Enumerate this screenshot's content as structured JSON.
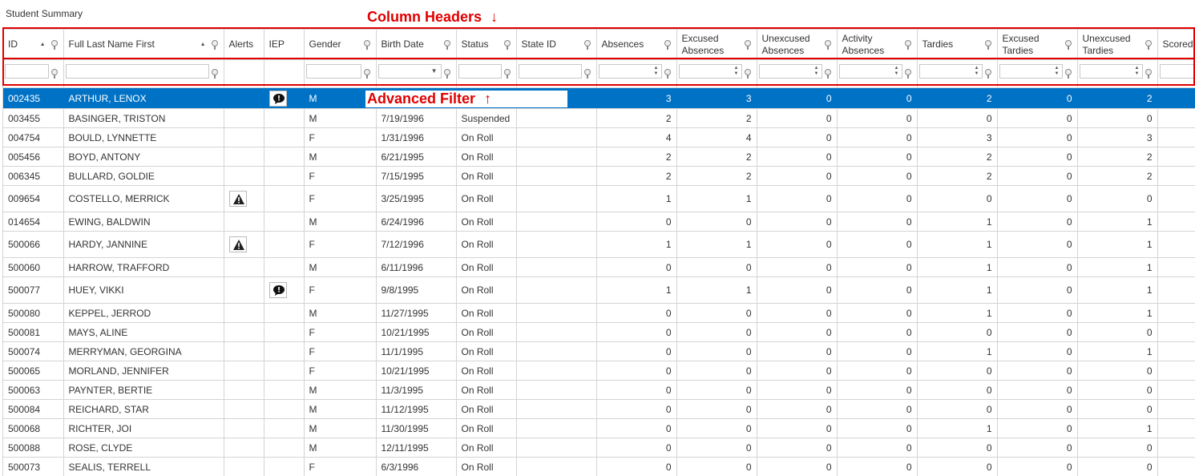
{
  "window": {
    "title": "Student Summary"
  },
  "annotations": {
    "column_headers": "Column Headers",
    "advanced_filter": "Advanced Filter",
    "color": "#e00000"
  },
  "colors": {
    "selected_row": "#0072c6"
  },
  "columns": [
    {
      "key": "id",
      "label": "ID",
      "sorted": "asc",
      "filter": "text"
    },
    {
      "key": "name",
      "label": "Full Last Name First",
      "sorted": "asc",
      "filter": "text"
    },
    {
      "key": "alerts",
      "label": "Alerts",
      "filter": "none"
    },
    {
      "key": "iep",
      "label": "IEP",
      "filter": "none"
    },
    {
      "key": "gender",
      "label": "Gender",
      "filter": "text"
    },
    {
      "key": "birth",
      "label": "Birth Date",
      "filter": "dropdown"
    },
    {
      "key": "status",
      "label": "Status",
      "filter": "text"
    },
    {
      "key": "stateid",
      "label": "State ID",
      "filter": "text"
    },
    {
      "key": "absences",
      "label": "Absences",
      "filter": "spin"
    },
    {
      "key": "excabs",
      "label": "Excused Absences",
      "filter": "spin"
    },
    {
      "key": "unexabs",
      "label": "Unexcused Absences",
      "filter": "spin"
    },
    {
      "key": "actabs",
      "label": "Activity Absences",
      "filter": "spin"
    },
    {
      "key": "tardies",
      "label": "Tardies",
      "filter": "spin"
    },
    {
      "key": "exctard",
      "label": "Excused Tardies",
      "filter": "spin"
    },
    {
      "key": "unextard",
      "label": "Unexcused Tardies",
      "filter": "spin"
    },
    {
      "key": "scored",
      "label": "Scored",
      "filter": "text"
    }
  ],
  "rows": [
    {
      "id": "002435",
      "name": "ARTHUR, LENOX",
      "alert": "",
      "iep": "speech-icon",
      "gender": "M",
      "birth": "",
      "status": "",
      "vals": [
        "3",
        "3",
        "0",
        "0",
        "2",
        "0",
        "2"
      ],
      "selected": true
    },
    {
      "id": "003455",
      "name": "BASINGER, TRISTON",
      "alert": "",
      "iep": "",
      "gender": "M",
      "birth": "7/19/1996",
      "status": "Suspended",
      "vals": [
        "2",
        "2",
        "0",
        "0",
        "0",
        "0",
        "0"
      ]
    },
    {
      "id": "004754",
      "name": "BOULD, LYNNETTE",
      "alert": "",
      "iep": "",
      "gender": "F",
      "birth": "1/31/1996",
      "status": "On Roll",
      "vals": [
        "4",
        "4",
        "0",
        "0",
        "3",
        "0",
        "3"
      ]
    },
    {
      "id": "005456",
      "name": "BOYD, ANTONY",
      "alert": "",
      "iep": "",
      "gender": "M",
      "birth": "6/21/1995",
      "status": "On Roll",
      "vals": [
        "2",
        "2",
        "0",
        "0",
        "2",
        "0",
        "2"
      ]
    },
    {
      "id": "006345",
      "name": "BULLARD, GOLDIE",
      "alert": "",
      "iep": "",
      "gender": "F",
      "birth": "7/15/1995",
      "status": "On Roll",
      "vals": [
        "2",
        "2",
        "0",
        "0",
        "2",
        "0",
        "2"
      ]
    },
    {
      "id": "009654",
      "name": "COSTELLO, MERRICK",
      "alert": "warning-icon",
      "iep": "",
      "gender": "F",
      "birth": "3/25/1995",
      "status": "On Roll",
      "vals": [
        "1",
        "1",
        "0",
        "0",
        "0",
        "0",
        "0"
      ]
    },
    {
      "id": "014654",
      "name": "EWING, BALDWIN",
      "alert": "",
      "iep": "",
      "gender": "M",
      "birth": "6/24/1996",
      "status": "On Roll",
      "vals": [
        "0",
        "0",
        "0",
        "0",
        "1",
        "0",
        "1"
      ]
    },
    {
      "id": "500066",
      "name": "HARDY, JANNINE",
      "alert": "warning-icon",
      "iep": "",
      "gender": "F",
      "birth": "7/12/1996",
      "status": "On Roll",
      "vals": [
        "1",
        "1",
        "0",
        "0",
        "1",
        "0",
        "1"
      ]
    },
    {
      "id": "500060",
      "name": "HARROW, TRAFFORD",
      "alert": "",
      "iep": "",
      "gender": "M",
      "birth": "6/11/1996",
      "status": "On Roll",
      "vals": [
        "0",
        "0",
        "0",
        "0",
        "1",
        "0",
        "1"
      ]
    },
    {
      "id": "500077",
      "name": "HUEY, VIKKI",
      "alert": "",
      "iep": "speech-icon",
      "gender": "F",
      "birth": "9/8/1995",
      "status": "On Roll",
      "vals": [
        "1",
        "1",
        "0",
        "0",
        "1",
        "0",
        "1"
      ]
    },
    {
      "id": "500080",
      "name": "KEPPEL, JERROD",
      "alert": "",
      "iep": "",
      "gender": "M",
      "birth": "11/27/1995",
      "status": "On Roll",
      "vals": [
        "0",
        "0",
        "0",
        "0",
        "1",
        "0",
        "1"
      ]
    },
    {
      "id": "500081",
      "name": "MAYS, ALINE",
      "alert": "",
      "iep": "",
      "gender": "F",
      "birth": "10/21/1995",
      "status": "On Roll",
      "vals": [
        "0",
        "0",
        "0",
        "0",
        "0",
        "0",
        "0"
      ]
    },
    {
      "id": "500074",
      "name": "MERRYMAN, GEORGINA",
      "alert": "",
      "iep": "",
      "gender": "F",
      "birth": "11/1/1995",
      "status": "On Roll",
      "vals": [
        "0",
        "0",
        "0",
        "0",
        "1",
        "0",
        "1"
      ]
    },
    {
      "id": "500065",
      "name": "MORLAND, JENNIFER",
      "alert": "",
      "iep": "",
      "gender": "F",
      "birth": "10/21/1995",
      "status": "On Roll",
      "vals": [
        "0",
        "0",
        "0",
        "0",
        "0",
        "0",
        "0"
      ]
    },
    {
      "id": "500063",
      "name": "PAYNTER, BERTIE",
      "alert": "",
      "iep": "",
      "gender": "M",
      "birth": "11/3/1995",
      "status": "On Roll",
      "vals": [
        "0",
        "0",
        "0",
        "0",
        "0",
        "0",
        "0"
      ]
    },
    {
      "id": "500084",
      "name": "REICHARD, STAR",
      "alert": "",
      "iep": "",
      "gender": "M",
      "birth": "11/12/1995",
      "status": "On Roll",
      "vals": [
        "0",
        "0",
        "0",
        "0",
        "0",
        "0",
        "0"
      ]
    },
    {
      "id": "500068",
      "name": "RICHTER, JOI",
      "alert": "",
      "iep": "",
      "gender": "M",
      "birth": "11/30/1995",
      "status": "On Roll",
      "vals": [
        "0",
        "0",
        "0",
        "0",
        "1",
        "0",
        "1"
      ]
    },
    {
      "id": "500088",
      "name": "ROSE, CLYDE",
      "alert": "",
      "iep": "",
      "gender": "M",
      "birth": "12/11/1995",
      "status": "On Roll",
      "vals": [
        "0",
        "0",
        "0",
        "0",
        "0",
        "0",
        "0"
      ]
    },
    {
      "id": "500073",
      "name": "SEALIS, TERRELL",
      "alert": "",
      "iep": "",
      "gender": "F",
      "birth": "6/3/1996",
      "status": "On Roll",
      "vals": [
        "0",
        "0",
        "0",
        "0",
        "0",
        "0",
        "0"
      ]
    }
  ]
}
